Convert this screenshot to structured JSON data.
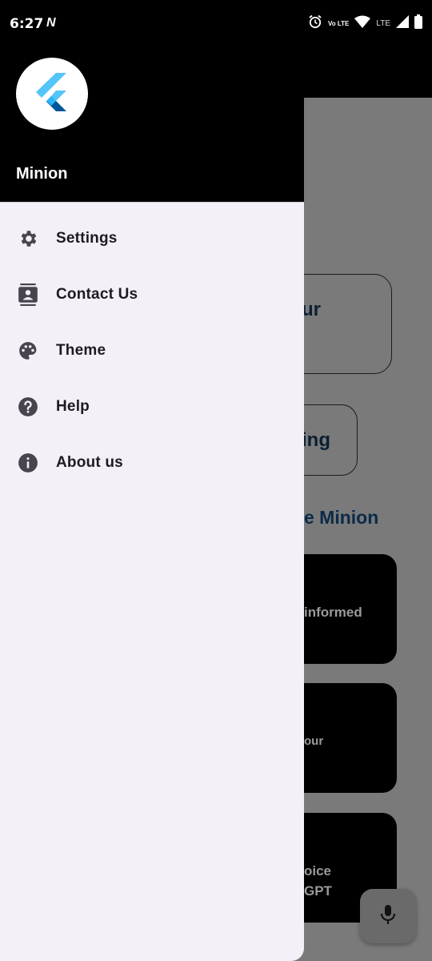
{
  "status_bar": {
    "time": "6:27",
    "notification_glyph": "N",
    "network_label": "LTE",
    "volte_label": "Vo LTE",
    "icons": [
      "alarm-icon",
      "volte-icon",
      "wifi-icon",
      "signal-icon",
      "battery-icon"
    ]
  },
  "drawer": {
    "account_name": "Minion",
    "logo_icon": "flutter-logo-icon",
    "items": [
      {
        "label": "Settings",
        "icon": "gear-icon"
      },
      {
        "label": "Contact Us",
        "icon": "contact-card-icon"
      },
      {
        "label": "Theme",
        "icon": "palette-icon"
      },
      {
        "label": "Help",
        "icon": "help-circle-icon"
      },
      {
        "label": "About us",
        "icon": "info-circle-icon"
      }
    ]
  },
  "background": {
    "card1_text": "ur",
    "card2_text": "ing",
    "heading_text": "e Minion",
    "feature_cards": [
      {
        "lines": [
          "informed"
        ]
      },
      {
        "lines": [
          "our"
        ]
      },
      {
        "lines": [
          "oice",
          "GPT"
        ]
      }
    ],
    "fab_icon": "mic-icon"
  },
  "colors": {
    "drawer_bg": "#f4f0f8",
    "header_bg": "#000000",
    "scrim": "#7a7a7a",
    "heading": "#0c2a4a"
  }
}
